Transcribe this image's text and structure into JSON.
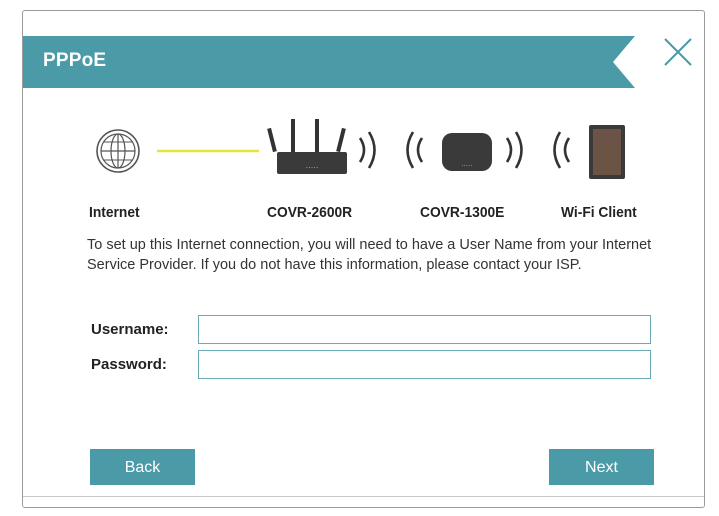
{
  "dialog": {
    "title": "PPPoE",
    "close_icon": "close-x-icon"
  },
  "topology": {
    "devices": [
      {
        "label": "Internet",
        "icon": "globe-icon"
      },
      {
        "label": "COVR-2600R",
        "icon": "router-icon"
      },
      {
        "label": "COVR-1300E",
        "icon": "extender-icon"
      },
      {
        "label": "Wi-Fi Client",
        "icon": "tablet-icon"
      }
    ]
  },
  "info": {
    "text": "To set up this Internet connection, you will need to have a User Name from your Internet Service Provider. If you do not have this information, please contact your ISP."
  },
  "form": {
    "username_label": "Username:",
    "username_value": "",
    "password_label": "Password:",
    "password_value": ""
  },
  "buttons": {
    "back_label": "Back",
    "next_label": "Next"
  },
  "colors": {
    "accent": "#4b9aa7",
    "connection_line": "#e8e33a",
    "icon_dark": "#444444"
  }
}
